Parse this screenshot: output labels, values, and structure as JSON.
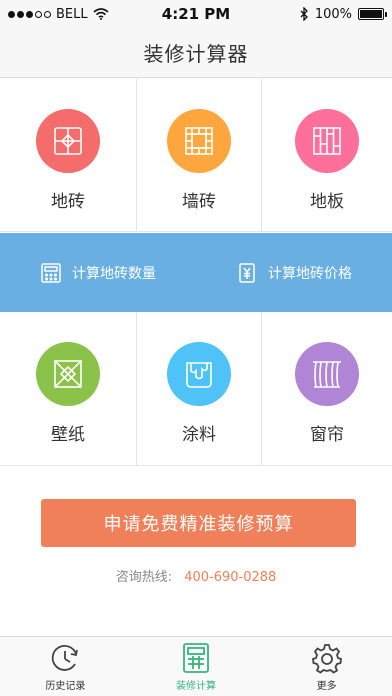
{
  "status_bar": {
    "carrier": "BELL",
    "time": "4:21 PM",
    "battery": "100%",
    "signal_dots_filled": 3,
    "signal_dots_total": 5
  },
  "header": {
    "title": "装修计算器"
  },
  "categories_top": [
    {
      "label": "地砖",
      "icon": "floor-tile-icon",
      "color": "#f56c6c"
    },
    {
      "label": "墙砖",
      "icon": "wall-tile-icon",
      "color": "#ffa63f"
    },
    {
      "label": "地板",
      "icon": "wood-floor-icon",
      "color": "#ff6f9c"
    }
  ],
  "calculators": [
    {
      "label": "计算地砖数量",
      "icon": "calculator-icon"
    },
    {
      "label": "计算地砖价格",
      "icon": "yen-icon"
    }
  ],
  "categories_bottom": [
    {
      "label": "壁纸",
      "icon": "wallpaper-icon",
      "color": "#8bc34a"
    },
    {
      "label": "涂料",
      "icon": "paint-bucket-icon",
      "color": "#4fc3f7"
    },
    {
      "label": "窗帘",
      "icon": "curtain-icon",
      "color": "#b085d6"
    }
  ],
  "cta": {
    "label": "申请免费精准装修预算"
  },
  "hotline": {
    "label": "咨询热线:",
    "phone": "400-690-0288"
  },
  "tabs": [
    {
      "label": "历史记录",
      "icon": "history-clock-icon",
      "active": false
    },
    {
      "label": "装修计算",
      "icon": "calculator-tab-icon",
      "active": true
    },
    {
      "label": "更多",
      "icon": "gear-icon",
      "active": false
    }
  ],
  "colors": {
    "accent": "#36b37e",
    "band": "#6aafe2",
    "cta": "#f0805a"
  }
}
